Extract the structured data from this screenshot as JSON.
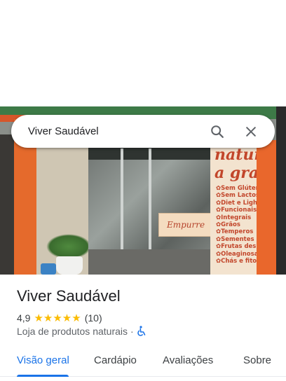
{
  "search": {
    "query": "Viver Saudável"
  },
  "photo": {
    "sign_headline_1": "natur",
    "sign_headline_2": "a gra",
    "sign_items": [
      "✿Sem Glúten",
      "✿Sem Lactose",
      "✿Diet e Light",
      "✿Funcionais",
      "✿Integrais",
      "✿Grãos",
      "✿Temperos",
      "✿Sementes",
      "✿Frutas desid",
      "✿Oleaginosas",
      "✿Chás e fitote"
    ],
    "door_sign": "Empurre"
  },
  "place": {
    "name": "Viver Saudável",
    "rating": "4,9",
    "stars": "★★★★★",
    "review_count": "(10)",
    "category": "Loja de produtos naturais",
    "separator": "·"
  },
  "tabs": [
    {
      "label": "Visão geral",
      "active": true
    },
    {
      "label": "Cardápio",
      "active": false
    },
    {
      "label": "Avaliações",
      "active": false
    },
    {
      "label": "Sobre",
      "active": false
    }
  ],
  "colors": {
    "accent": "#1a73e8",
    "star": "#fbbc04"
  },
  "icons": {
    "search": "search-icon",
    "close": "close-icon",
    "accessibility": "wheelchair-icon"
  }
}
